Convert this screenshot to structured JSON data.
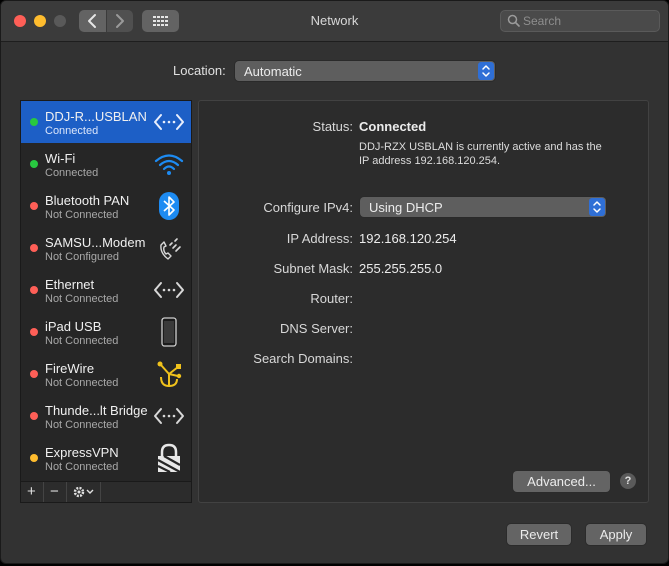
{
  "window": {
    "title": "Network"
  },
  "search": {
    "placeholder": "Search"
  },
  "location": {
    "label": "Location:",
    "value": "Automatic"
  },
  "services": [
    {
      "name": "DDJ-R...USBLAN",
      "status": "Connected",
      "status_color": "#28c840",
      "icon": "ethernet-arrows-icon",
      "selected": true
    },
    {
      "name": "Wi-Fi",
      "status": "Connected",
      "status_color": "#28c840",
      "icon": "wifi-icon"
    },
    {
      "name": "Bluetooth PAN",
      "status": "Not Connected",
      "status_color": "#fe5f57",
      "icon": "bluetooth-icon"
    },
    {
      "name": "SAMSU...Modem",
      "status": "Not Configured",
      "status_color": "#fe5f57",
      "icon": "phone-modem-icon"
    },
    {
      "name": "Ethernet",
      "status": "Not Connected",
      "status_color": "#fe5f57",
      "icon": "ethernet-arrows-icon"
    },
    {
      "name": "iPad USB",
      "status": "Not Connected",
      "status_color": "#fe5f57",
      "icon": "ipad-icon"
    },
    {
      "name": "FireWire",
      "status": "Not Connected",
      "status_color": "#fe5f57",
      "icon": "firewire-icon"
    },
    {
      "name": "Thunde...lt Bridge",
      "status": "Not Connected",
      "status_color": "#fe5f57",
      "icon": "ethernet-arrows-icon"
    },
    {
      "name": "ExpressVPN",
      "status": "Not Connected",
      "status_color": "#febc2e",
      "icon": "vpn-lock-icon"
    }
  ],
  "sidebar_tools": {
    "add": "+",
    "remove": "−"
  },
  "detail": {
    "status_label": "Status:",
    "status_value": "Connected",
    "status_description": "DDJ-RZX USBLAN is currently active and has the IP address 192.168.120.254.",
    "configure_label": "Configure IPv4:",
    "configure_value": "Using DHCP",
    "ip_label": "IP Address:",
    "ip_value": "192.168.120.254",
    "subnet_label": "Subnet Mask:",
    "subnet_value": "255.255.255.0",
    "router_label": "Router:",
    "dns_label": "DNS Server:",
    "search_domains_label": "Search Domains:"
  },
  "buttons": {
    "advanced": "Advanced...",
    "help": "?",
    "revert": "Revert",
    "apply": "Apply"
  }
}
